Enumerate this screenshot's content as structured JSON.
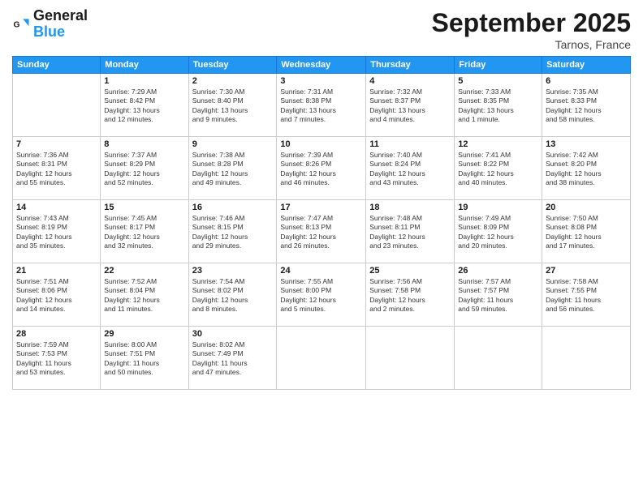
{
  "logo": {
    "text_general": "General",
    "text_blue": "Blue"
  },
  "header": {
    "month_year": "September 2025",
    "location": "Tarnos, France"
  },
  "weekdays": [
    "Sunday",
    "Monday",
    "Tuesday",
    "Wednesday",
    "Thursday",
    "Friday",
    "Saturday"
  ],
  "weeks": [
    [
      {
        "day": "",
        "info": ""
      },
      {
        "day": "1",
        "info": "Sunrise: 7:29 AM\nSunset: 8:42 PM\nDaylight: 13 hours\nand 12 minutes."
      },
      {
        "day": "2",
        "info": "Sunrise: 7:30 AM\nSunset: 8:40 PM\nDaylight: 13 hours\nand 9 minutes."
      },
      {
        "day": "3",
        "info": "Sunrise: 7:31 AM\nSunset: 8:38 PM\nDaylight: 13 hours\nand 7 minutes."
      },
      {
        "day": "4",
        "info": "Sunrise: 7:32 AM\nSunset: 8:37 PM\nDaylight: 13 hours\nand 4 minutes."
      },
      {
        "day": "5",
        "info": "Sunrise: 7:33 AM\nSunset: 8:35 PM\nDaylight: 13 hours\nand 1 minute."
      },
      {
        "day": "6",
        "info": "Sunrise: 7:35 AM\nSunset: 8:33 PM\nDaylight: 12 hours\nand 58 minutes."
      }
    ],
    [
      {
        "day": "7",
        "info": "Sunrise: 7:36 AM\nSunset: 8:31 PM\nDaylight: 12 hours\nand 55 minutes."
      },
      {
        "day": "8",
        "info": "Sunrise: 7:37 AM\nSunset: 8:29 PM\nDaylight: 12 hours\nand 52 minutes."
      },
      {
        "day": "9",
        "info": "Sunrise: 7:38 AM\nSunset: 8:28 PM\nDaylight: 12 hours\nand 49 minutes."
      },
      {
        "day": "10",
        "info": "Sunrise: 7:39 AM\nSunset: 8:26 PM\nDaylight: 12 hours\nand 46 minutes."
      },
      {
        "day": "11",
        "info": "Sunrise: 7:40 AM\nSunset: 8:24 PM\nDaylight: 12 hours\nand 43 minutes."
      },
      {
        "day": "12",
        "info": "Sunrise: 7:41 AM\nSunset: 8:22 PM\nDaylight: 12 hours\nand 40 minutes."
      },
      {
        "day": "13",
        "info": "Sunrise: 7:42 AM\nSunset: 8:20 PM\nDaylight: 12 hours\nand 38 minutes."
      }
    ],
    [
      {
        "day": "14",
        "info": "Sunrise: 7:43 AM\nSunset: 8:19 PM\nDaylight: 12 hours\nand 35 minutes."
      },
      {
        "day": "15",
        "info": "Sunrise: 7:45 AM\nSunset: 8:17 PM\nDaylight: 12 hours\nand 32 minutes."
      },
      {
        "day": "16",
        "info": "Sunrise: 7:46 AM\nSunset: 8:15 PM\nDaylight: 12 hours\nand 29 minutes."
      },
      {
        "day": "17",
        "info": "Sunrise: 7:47 AM\nSunset: 8:13 PM\nDaylight: 12 hours\nand 26 minutes."
      },
      {
        "day": "18",
        "info": "Sunrise: 7:48 AM\nSunset: 8:11 PM\nDaylight: 12 hours\nand 23 minutes."
      },
      {
        "day": "19",
        "info": "Sunrise: 7:49 AM\nSunset: 8:09 PM\nDaylight: 12 hours\nand 20 minutes."
      },
      {
        "day": "20",
        "info": "Sunrise: 7:50 AM\nSunset: 8:08 PM\nDaylight: 12 hours\nand 17 minutes."
      }
    ],
    [
      {
        "day": "21",
        "info": "Sunrise: 7:51 AM\nSunset: 8:06 PM\nDaylight: 12 hours\nand 14 minutes."
      },
      {
        "day": "22",
        "info": "Sunrise: 7:52 AM\nSunset: 8:04 PM\nDaylight: 12 hours\nand 11 minutes."
      },
      {
        "day": "23",
        "info": "Sunrise: 7:54 AM\nSunset: 8:02 PM\nDaylight: 12 hours\nand 8 minutes."
      },
      {
        "day": "24",
        "info": "Sunrise: 7:55 AM\nSunset: 8:00 PM\nDaylight: 12 hours\nand 5 minutes."
      },
      {
        "day": "25",
        "info": "Sunrise: 7:56 AM\nSunset: 7:58 PM\nDaylight: 12 hours\nand 2 minutes."
      },
      {
        "day": "26",
        "info": "Sunrise: 7:57 AM\nSunset: 7:57 PM\nDaylight: 11 hours\nand 59 minutes."
      },
      {
        "day": "27",
        "info": "Sunrise: 7:58 AM\nSunset: 7:55 PM\nDaylight: 11 hours\nand 56 minutes."
      }
    ],
    [
      {
        "day": "28",
        "info": "Sunrise: 7:59 AM\nSunset: 7:53 PM\nDaylight: 11 hours\nand 53 minutes."
      },
      {
        "day": "29",
        "info": "Sunrise: 8:00 AM\nSunset: 7:51 PM\nDaylight: 11 hours\nand 50 minutes."
      },
      {
        "day": "30",
        "info": "Sunrise: 8:02 AM\nSunset: 7:49 PM\nDaylight: 11 hours\nand 47 minutes."
      },
      {
        "day": "",
        "info": ""
      },
      {
        "day": "",
        "info": ""
      },
      {
        "day": "",
        "info": ""
      },
      {
        "day": "",
        "info": ""
      }
    ]
  ]
}
